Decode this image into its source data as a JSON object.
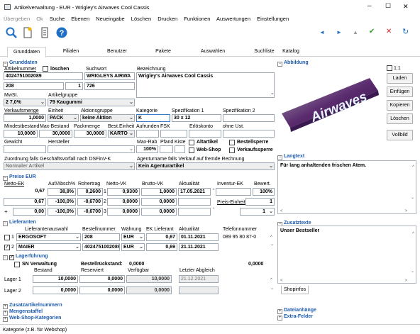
{
  "window": {
    "title": "Artikelverwaltung - EUR - Wrigley's Airwaves Cool Cassis",
    "minimize": "–",
    "maximize": "☐",
    "close": "✕"
  },
  "menu": [
    "Übergeben",
    "Ok",
    "Suche",
    "Ebenen",
    "Neueingabe",
    "Löschen",
    "Drucken",
    "Funktionen",
    "Auswertungen",
    "Einstellungen"
  ],
  "toolbar": {
    "icons": [
      "search-icon",
      "new-document-icon",
      "copy-document-icon",
      "help-icon"
    ],
    "nav": [
      "◄",
      "►",
      "▲",
      "✔",
      "✕",
      "↻"
    ]
  },
  "tabs": [
    "Grunddaten",
    "Filialen",
    "Benutzer",
    "Pakete",
    "Auswahlen",
    "Suchliste",
    "Katalog"
  ],
  "grunddaten": {
    "title": "Grunddaten",
    "artikelnummer_label": "Artikelnummer",
    "loeschen_label": "löschen",
    "artikelnummer": "4024751002089",
    "suchwort_label": "Suchwort",
    "suchwort": "WRIGLEYS AIRWA",
    "bezeichnung_label": "Bezeichnung",
    "bezeichnung": "Wrigley's Airwaves Cool Cassis",
    "f1": "208",
    "f2": "1",
    "f3": "726",
    "mwst_label": "MwSt.",
    "artikelgruppe_label": "Artikelgruppe",
    "mwst": "2 7,0%",
    "artikelgruppe": "79 Kaugummi",
    "verkaufsmenge_label": "Verkaufsmenge",
    "einheit_label": "Einheit",
    "aktionsgruppe_label": "Aktionsgruppe",
    "kategorie_label": "Kategorie",
    "spez1_label": "Spezifikation 1",
    "spez2_label": "Spezifikation 2",
    "verkaufsmenge": "1,0000",
    "einheit": "PACK",
    "aktionsgruppe": "keine Aktion",
    "kategorie": "K",
    "spez1": "30 x 12",
    "mindest_label": "Mindestbestand",
    "maxbestand_label": "Max-Bestand",
    "packmenge_label": "Packmenge",
    "besteinheit_label": "Best.Einheit",
    "aufrunden_label": "Aufrunden",
    "fsk_label": "FSK",
    "erloeskonto_label": "Erlöskonto",
    "ohneust_label": "ohne Ust.",
    "mindest": "10,0000",
    "maxbestand": "30,0000",
    "packmenge": "30,0000",
    "besteinheit": "KARTO",
    "gewicht_label": "Gewicht",
    "hersteller_label": "Hersteller",
    "maxrab_label": "Max-Rab",
    "pfand_label": "Pfand",
    "kiste_label": "Kiste",
    "maxrab": "100%",
    "altartikel_label": "Altartikel",
    "bestellsperre_label": "Bestellsperre",
    "webshop_label": "Web-Shop",
    "verkaufssperre_label": "Verkaufssperre",
    "zuordnung_label": "Zuordnung falls Geschäftsvorfall nach DSFinV-K",
    "zuordnung": "Normaler Artikel",
    "agentur_label": "Agenturname falls Verkauf auf fremde Rechnung",
    "agentur": "Kein Agenturartikel"
  },
  "preise": {
    "title": "Preise EUR",
    "h_nettoek": "Netto-EK",
    "h_aufabsch": "Auf/Absch%",
    "h_rohertrag": "Rohertrag",
    "h_nettovk": "Netto-VK",
    "h_bruttovk": "Brutto-VK",
    "h_aktualitaet": "Aktualität",
    "h_inventur": "Inventur-EK",
    "h_bewert": "Bewert.",
    "rows": [
      {
        "nettoek": "0,67",
        "auf": "38,8%",
        "roh": "0,2600",
        "idx": "1",
        "nettovk": "0,9300",
        "bruttovk": "1,0000",
        "datum": "17.05.2021"
      },
      {
        "nettoek": "0,67",
        "auf": "-100,0%",
        "roh": "-0,6700",
        "idx": "2",
        "nettovk": "0,0000",
        "bruttovk": "0,0000",
        "datum": ""
      },
      {
        "nettoek": "0,00",
        "auf": "-100,0%",
        "roh": "-0,6700",
        "idx": "3",
        "nettovk": "0,0000",
        "bruttovk": "0,0000",
        "datum": ""
      }
    ],
    "eur": "EUR",
    "bewert": "100%",
    "preiseinheit_label": "Preis-Einheit",
    "preiseinheit": "1",
    "last": "1",
    "plus": "+"
  },
  "lieferanten": {
    "title": "Lieferanten",
    "h_auswahl": "Lieferantenauswahl",
    "h_bestellnummer": "Bestellnummer",
    "h_waehrung": "Währung",
    "h_ek": "EK Lieferant",
    "h_akt": "Aktualität",
    "h_tel": "Telefonnummer",
    "rows": [
      {
        "idx": "1",
        "name": "ERGOSOFT",
        "best": "208",
        "cur": "EUR",
        "ek": "0,67",
        "datum": "01.11.2021",
        "tel": "089 95 80 87-0"
      },
      {
        "idx": "2",
        "name": "MAIER",
        "best": "4024751002089",
        "cur": "EUR",
        "ek": "0,69",
        "datum": "21.11.2021",
        "tel": ""
      }
    ]
  },
  "lager": {
    "title": "Lagerführung",
    "sn_label": "SN Verwaltung",
    "bestellrueckstand_label": "Bestellrückstand:",
    "bestellrueckstand": "0,0000",
    "right_val": "0,0000",
    "h_bestand": "Bestand",
    "h_reserviert": "Reserviert",
    "h_verfuegbar": "Verfügbar",
    "h_abgleich": "Letzter Abgleich",
    "rows": [
      {
        "label": "Lager 1",
        "bestand": "10,0000",
        "res": "0,0000",
        "verf": "10,0000",
        "datum": "21.12.2021"
      },
      {
        "label": "Lager 2",
        "bestand": "0,0000",
        "res": "0,0000",
        "verf": "0,0000",
        "datum": ""
      }
    ]
  },
  "collapsed": [
    "Zusatzartikelnummern",
    "Mengenstaffel",
    "Web-Shop-Kategorien"
  ],
  "right": {
    "abbildung_title": "Abbildung",
    "ratio_label": "1:1",
    "buttons": [
      "Laden",
      "Einfügen",
      "Kopieren",
      "Löschen",
      "Vollbild"
    ],
    "brand": "Airwaves",
    "langtext_title": "Langtext",
    "langtext": "Für lang anhaltenden frischen Atem.",
    "zusatz_title": "Zusatztexte",
    "zusatz": "Unser Bestseller",
    "shopinfos": "Shopinfos",
    "dateianhaenge": "Dateianhänge",
    "extrafelder": "Extra-Felder"
  },
  "status": "Kategorie (z.B. für Webshop)"
}
